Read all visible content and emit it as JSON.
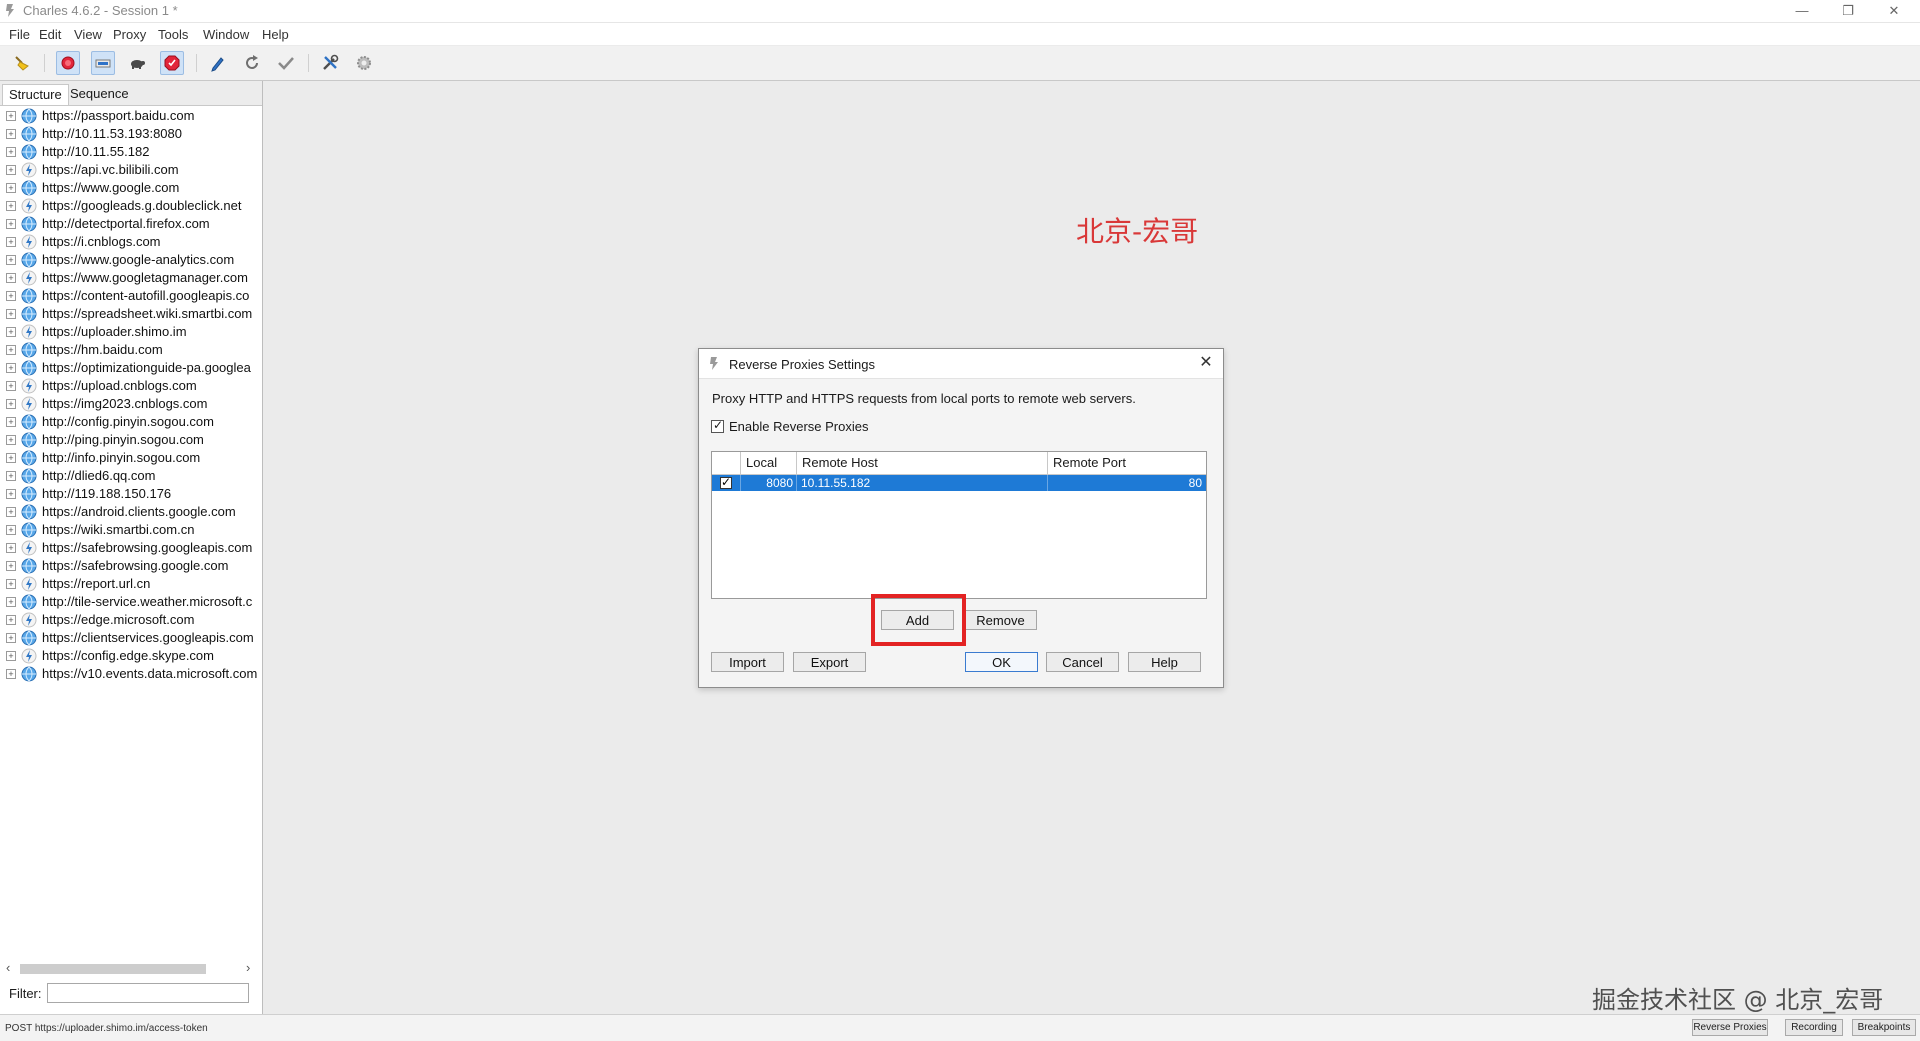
{
  "window": {
    "title": "Charles 4.6.2 - Session 1 *"
  },
  "menu": [
    "File",
    "Edit",
    "View",
    "Proxy",
    "Tools",
    "Window",
    "Help"
  ],
  "toolbar": {
    "icons": [
      "broom-icon",
      "record-icon",
      "throttle-icon",
      "turtle-icon",
      "breakpoint-icon",
      "pen-icon",
      "refresh-icon",
      "check-icon",
      "tools-icon",
      "gear-icon"
    ]
  },
  "left_panel": {
    "tabs": [
      "Structure",
      "Sequence"
    ],
    "hosts": [
      {
        "label": "https://passport.baidu.com",
        "icon": "globe"
      },
      {
        "label": "http://10.11.53.193:8080",
        "icon": "globe"
      },
      {
        "label": "http://10.11.55.182",
        "icon": "globe"
      },
      {
        "label": "https://api.vc.bilibili.com",
        "icon": "bolt"
      },
      {
        "label": "https://www.google.com",
        "icon": "globe"
      },
      {
        "label": "https://googleads.g.doubleclick.net",
        "icon": "bolt"
      },
      {
        "label": "http://detectportal.firefox.com",
        "icon": "globe"
      },
      {
        "label": "https://i.cnblogs.com",
        "icon": "bolt"
      },
      {
        "label": "https://www.google-analytics.com",
        "icon": "globe"
      },
      {
        "label": "https://www.googletagmanager.com",
        "icon": "bolt"
      },
      {
        "label": "https://content-autofill.googleapis.co",
        "icon": "globe"
      },
      {
        "label": "https://spreadsheet.wiki.smartbi.com",
        "icon": "globe"
      },
      {
        "label": "https://uploader.shimo.im",
        "icon": "bolt"
      },
      {
        "label": "https://hm.baidu.com",
        "icon": "globe"
      },
      {
        "label": "https://optimizationguide-pa.googlea",
        "icon": "globe"
      },
      {
        "label": "https://upload.cnblogs.com",
        "icon": "bolt"
      },
      {
        "label": "https://img2023.cnblogs.com",
        "icon": "bolt"
      },
      {
        "label": "http://config.pinyin.sogou.com",
        "icon": "globe"
      },
      {
        "label": "http://ping.pinyin.sogou.com",
        "icon": "globe"
      },
      {
        "label": "http://info.pinyin.sogou.com",
        "icon": "globe"
      },
      {
        "label": "http://dlied6.qq.com",
        "icon": "globe"
      },
      {
        "label": "http://119.188.150.176",
        "icon": "globe"
      },
      {
        "label": "https://android.clients.google.com",
        "icon": "globe"
      },
      {
        "label": "https://wiki.smartbi.com.cn",
        "icon": "globe"
      },
      {
        "label": "https://safebrowsing.googleapis.com",
        "icon": "bolt"
      },
      {
        "label": "https://safebrowsing.google.com",
        "icon": "globe"
      },
      {
        "label": "https://report.url.cn",
        "icon": "bolt"
      },
      {
        "label": "http://tile-service.weather.microsoft.c",
        "icon": "globe"
      },
      {
        "label": "https://edge.microsoft.com",
        "icon": "bolt"
      },
      {
        "label": "https://clientservices.googleapis.com",
        "icon": "globe"
      },
      {
        "label": "https://config.edge.skype.com",
        "icon": "bolt"
      },
      {
        "label": "https://v10.events.data.microsoft.com",
        "icon": "globe"
      }
    ],
    "filter_label": "Filter:",
    "filter_value": ""
  },
  "watermark_top": "北京-宏哥",
  "watermark_bottom": "掘金技术社区 @ 北京_宏哥",
  "dialog": {
    "title": "Reverse Proxies Settings",
    "description": "Proxy HTTP and HTTPS requests from local ports to remote web servers.",
    "enable_label": "Enable Reverse Proxies",
    "enable_checked": true,
    "columns": [
      "Local Port",
      "Remote Host",
      "Remote Port"
    ],
    "rows": [
      {
        "enabled": true,
        "local_port": "8080",
        "remote_host": "10.11.55.182",
        "remote_port": "80"
      }
    ],
    "buttons": {
      "add": "Add",
      "remove": "Remove",
      "import": "Import",
      "export": "Export",
      "ok": "OK",
      "cancel": "Cancel",
      "help": "Help"
    }
  },
  "status": {
    "text": "POST https://uploader.shimo.im/access-token",
    "buttons": [
      "Reverse Proxies",
      "Recording",
      "Breakpoints"
    ]
  },
  "colors": {
    "selection": "#1e7ad6",
    "highlight": "#e32323",
    "watermark": "#d93838"
  }
}
